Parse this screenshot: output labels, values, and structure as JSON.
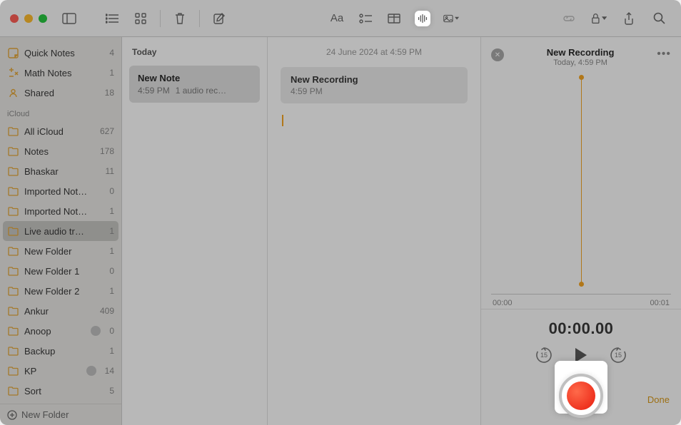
{
  "sidebar": {
    "top": [
      {
        "icon": "quick",
        "label": "Quick Notes",
        "count": "4"
      },
      {
        "icon": "math",
        "label": "Math Notes",
        "count": "1"
      },
      {
        "icon": "shared",
        "label": "Shared",
        "count": "18"
      }
    ],
    "section_label": "iCloud",
    "folders": [
      {
        "label": "All iCloud",
        "count": "627"
      },
      {
        "label": "Notes",
        "count": "178"
      },
      {
        "label": "Bhaskar",
        "count": "11"
      },
      {
        "label": "Imported Not…",
        "count": "0"
      },
      {
        "label": "Imported Not…",
        "count": "1"
      },
      {
        "label": "Live audio tr…",
        "count": "1",
        "selected": true
      },
      {
        "label": "New Folder",
        "count": "1"
      },
      {
        "label": "New Folder 1",
        "count": "0"
      },
      {
        "label": "New Folder 2",
        "count": "1"
      },
      {
        "label": "Ankur",
        "count": "409"
      },
      {
        "label": "Anoop",
        "count": "0",
        "shared": true
      },
      {
        "label": "Backup",
        "count": "1"
      },
      {
        "label": "KP",
        "count": "14",
        "shared": true
      },
      {
        "label": "Sort",
        "count": "5"
      }
    ],
    "footer": "New Folder"
  },
  "notelist": {
    "section": "Today",
    "items": [
      {
        "title": "New Note",
        "time": "4:59 PM",
        "preview": "1 audio rec…",
        "selected": true
      }
    ]
  },
  "editor": {
    "datestamp": "24 June 2024  at  4:59 PM",
    "chip_title": "New Recording",
    "chip_time": "4:59 PM"
  },
  "audio": {
    "title": "New Recording",
    "subtitle": "Today, 4:59 PM",
    "time_start": "00:00",
    "time_end": "00:01",
    "big_time": "00:00.00",
    "skip_amount": "15",
    "done": "Done"
  }
}
